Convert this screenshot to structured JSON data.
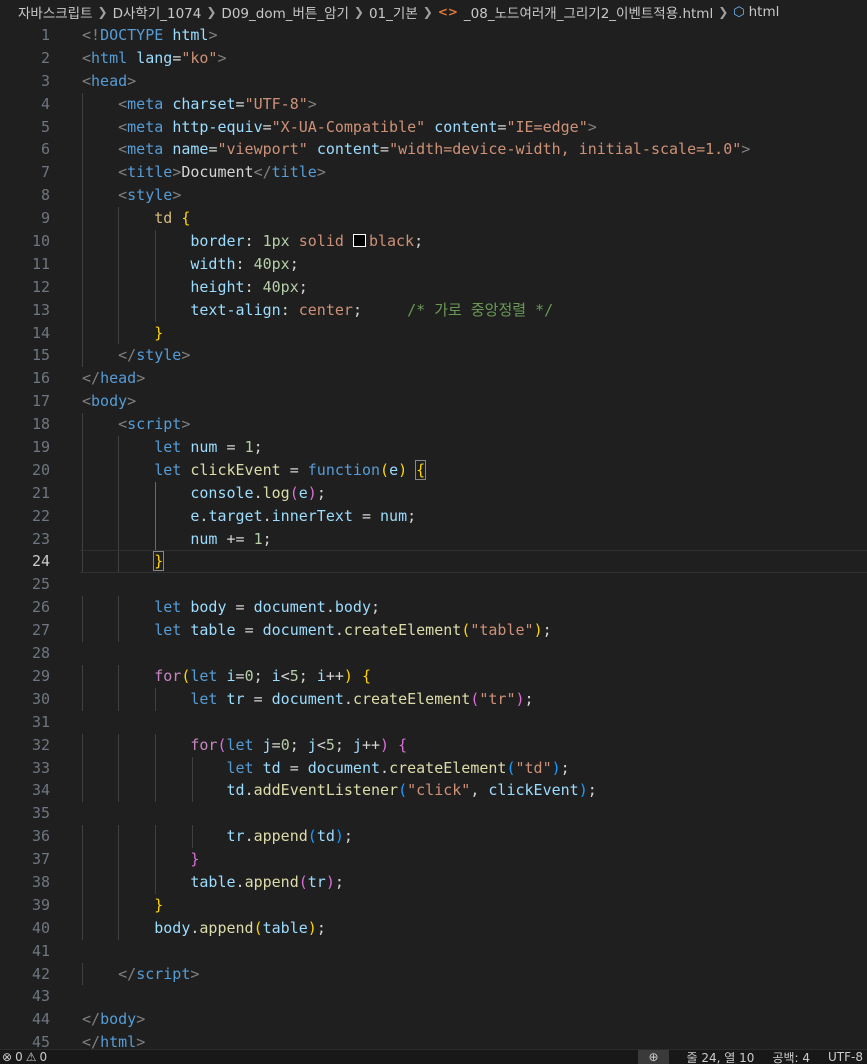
{
  "breadcrumb": {
    "items": [
      "자바스크립트",
      "D사학기_1074",
      "D09_dom_버튼_암기",
      "01_기본",
      "_08_노드여러개_그리기2_이벤트적용.html",
      "html"
    ]
  },
  "editor": {
    "active_line": 24,
    "lines": [
      "1",
      "2",
      "3",
      "4",
      "5",
      "6",
      "7",
      "8",
      "9",
      "10",
      "11",
      "12",
      "13",
      "14",
      "15",
      "16",
      "17",
      "18",
      "19",
      "20",
      "21",
      "22",
      "23",
      "24",
      "25",
      "26",
      "27",
      "28",
      "29",
      "30",
      "31",
      "32",
      "33",
      "34",
      "35",
      "36",
      "37",
      "38",
      "39",
      "40",
      "41",
      "42",
      "43",
      "44",
      "45"
    ]
  },
  "statusbar": {
    "errors": "0",
    "warnings": "0",
    "position": "줄 24, 열 10",
    "spaces": "공백: 4",
    "encoding": "UTF-8"
  },
  "colors": {
    "background": "#1f1f1f",
    "keyword": "#569cd6",
    "string": "#ce9178",
    "function": "#dcdcaa",
    "variable": "#9cdcfe",
    "comment": "#6a9955"
  }
}
